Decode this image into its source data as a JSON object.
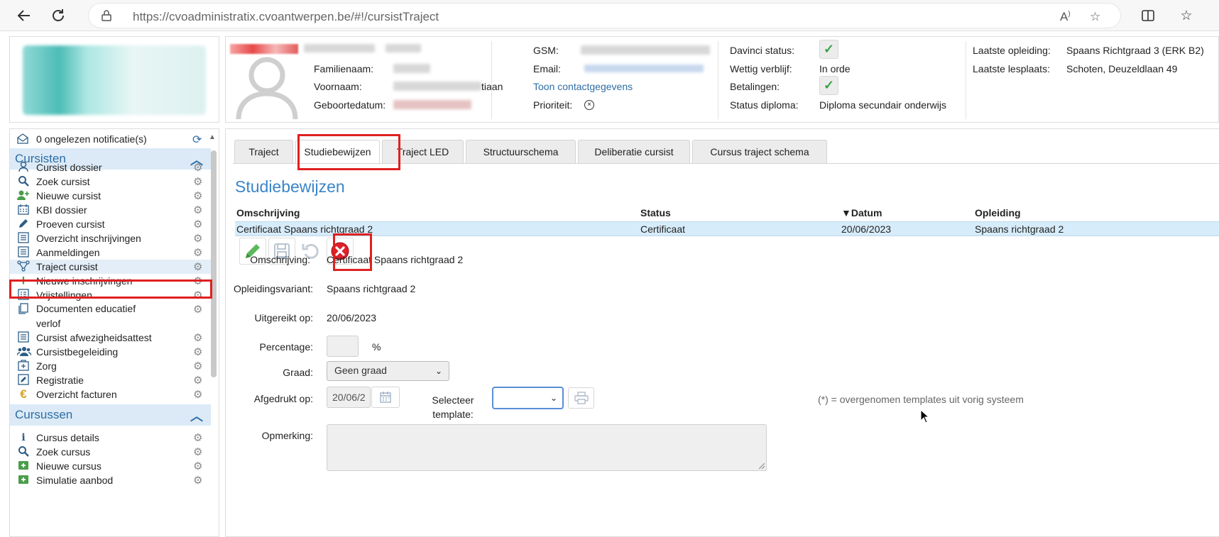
{
  "browser": {
    "url": "https://cvoadministratix.cvoantwerpen.be/#!/cursistTraject"
  },
  "sidebar": {
    "notifications": "0 ongelezen notificatie(s)",
    "sections": [
      {
        "title": "Cursisten",
        "items": [
          {
            "label": "Cursist dossier",
            "icon": "user-icon"
          },
          {
            "label": "Zoek cursist",
            "icon": "search-icon"
          },
          {
            "label": "Nieuwe cursist",
            "icon": "user-plus-icon"
          },
          {
            "label": "KBI dossier",
            "icon": "calendar-icon"
          },
          {
            "label": "Proeven cursist",
            "icon": "pencil-icon"
          },
          {
            "label": "Overzicht inschrijvingen",
            "icon": "list-icon"
          },
          {
            "label": "Aanmeldingen",
            "icon": "list-icon"
          },
          {
            "label": "Traject cursist",
            "icon": "route-icon"
          },
          {
            "label": "Nieuwe inschrijvingen",
            "icon": "plus-icon"
          },
          {
            "label": "Vrijstellingen",
            "icon": "checklist-icon"
          },
          {
            "label": "Documenten educatief verlof",
            "icon": "documents-icon"
          },
          {
            "label": "Cursist afwezigheidsattest",
            "icon": "list-icon"
          },
          {
            "label": "Cursistbegeleiding",
            "icon": "group-icon"
          },
          {
            "label": "Zorg",
            "icon": "medical-icon"
          },
          {
            "label": "Registratie",
            "icon": "edit-icon"
          },
          {
            "label": "Overzicht facturen",
            "icon": "euro-icon"
          }
        ]
      },
      {
        "title": "Cursussen",
        "items": [
          {
            "label": "Cursus details",
            "icon": "info-icon"
          },
          {
            "label": "Zoek cursus",
            "icon": "search-icon"
          },
          {
            "label": "Nieuwe cursus",
            "icon": "add-box-icon"
          },
          {
            "label": "Simulatie aanbod",
            "icon": "add-box-icon"
          }
        ]
      }
    ]
  },
  "header": {
    "familienaam_label": "Familienaam:",
    "voornaam_label": "Voornaam:",
    "voornaam_suffix": "tiaan",
    "geboortedatum_label": "Geboortedatum:",
    "gsm_label": "GSM:",
    "email_label": "Email:",
    "contact_link": "Toon contactgegevens",
    "prioriteit_label": "Prioriteit:",
    "davinci_label": "Davinci status:",
    "wettig_label": "Wettig verblijf:",
    "wettig_value": "In orde",
    "betalingen_label": "Betalingen:",
    "diploma_label": "Status diploma:",
    "diploma_value": "Diploma secundair onderwijs",
    "laatste_opleiding_label": "Laatste opleiding:",
    "laatste_opleiding_value": "Spaans Richtgraad 3 (ERK B2)",
    "laatste_lesplaats_label": "Laatste lesplaats:",
    "laatste_lesplaats_value": "Schoten, Deuzeldlaan 49"
  },
  "tabs": [
    "Traject",
    "Studiebewijzen",
    "Traject LED",
    "Structuurschema",
    "Deliberatie cursist",
    "Cursus traject schema"
  ],
  "main": {
    "title": "Studiebewijzen",
    "columns": [
      "Omschrijving",
      "Status",
      "▼Datum",
      "Opleiding"
    ],
    "row": {
      "omschrijving": "Certificaat Spaans richtgraad 2",
      "status": "Certificaat",
      "datum": "20/06/2023",
      "opleiding": "Spaans richtgraad 2"
    },
    "form": {
      "omschrijving_label": "Omschrijving:",
      "omschrijving_value": "Certificaat Spaans richtgraad 2",
      "variant_label": "Opleidingsvariant:",
      "variant_value": "Spaans richtgraad 2",
      "uitgereikt_label": "Uitgereikt op:",
      "uitgereikt_value": "20/06/2023",
      "percentage_label": "Percentage:",
      "percentage_unit": "%",
      "graad_label": "Graad:",
      "graad_value": "Geen graad",
      "afgedrukt_label": "Afgedrukt op:",
      "afgedrukt_value": "20/06/2",
      "template_label": "Selecteer template:",
      "template_note": "(*) = overgenomen templates uit vorig systeem",
      "opmerking_label": "Opmerking:"
    }
  }
}
